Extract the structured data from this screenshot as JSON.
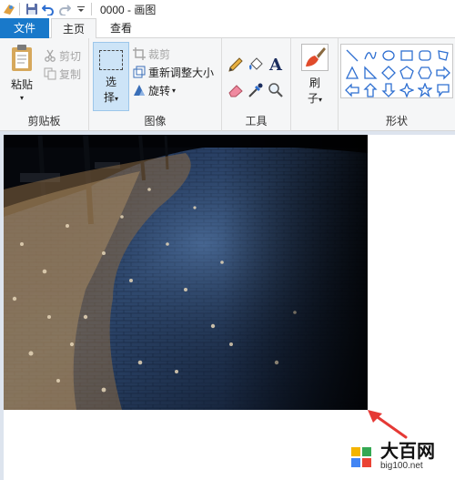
{
  "titlebar": {
    "title": "0000 - 画图"
  },
  "tabs": {
    "file": "文件",
    "home": "主页",
    "view": "查看"
  },
  "clipboard": {
    "paste": "粘贴",
    "cut": "剪切",
    "copy": "复制",
    "group_label": "剪贴板"
  },
  "image": {
    "select_line1": "选",
    "select_line2": "择",
    "crop": "裁剪",
    "resize": "重新调整大小",
    "rotate": "旋转",
    "group_label": "图像"
  },
  "tools": {
    "group_label": "工具"
  },
  "brushes": {
    "line1": "刷",
    "line2": "子"
  },
  "shapes": {
    "group_label": "形状"
  },
  "watermark": {
    "title": "大百网",
    "url": "big100.net"
  },
  "colors": {
    "accent": "#1979ca",
    "ribbon_bg": "#f5f6f7",
    "selected_bg": "#cde4f7",
    "arrow": "#e53935"
  },
  "icons": [
    "app-paint-icon",
    "save-icon",
    "undo-icon",
    "redo-icon",
    "customize-dropdown-icon",
    "paste-icon",
    "scissors-icon",
    "copy-icon",
    "crop-icon",
    "resize-icon",
    "rotate-icon",
    "pencil-icon",
    "fill-icon",
    "text-icon",
    "eraser-icon",
    "color-picker-icon",
    "magnifier-icon",
    "brush-icon"
  ]
}
